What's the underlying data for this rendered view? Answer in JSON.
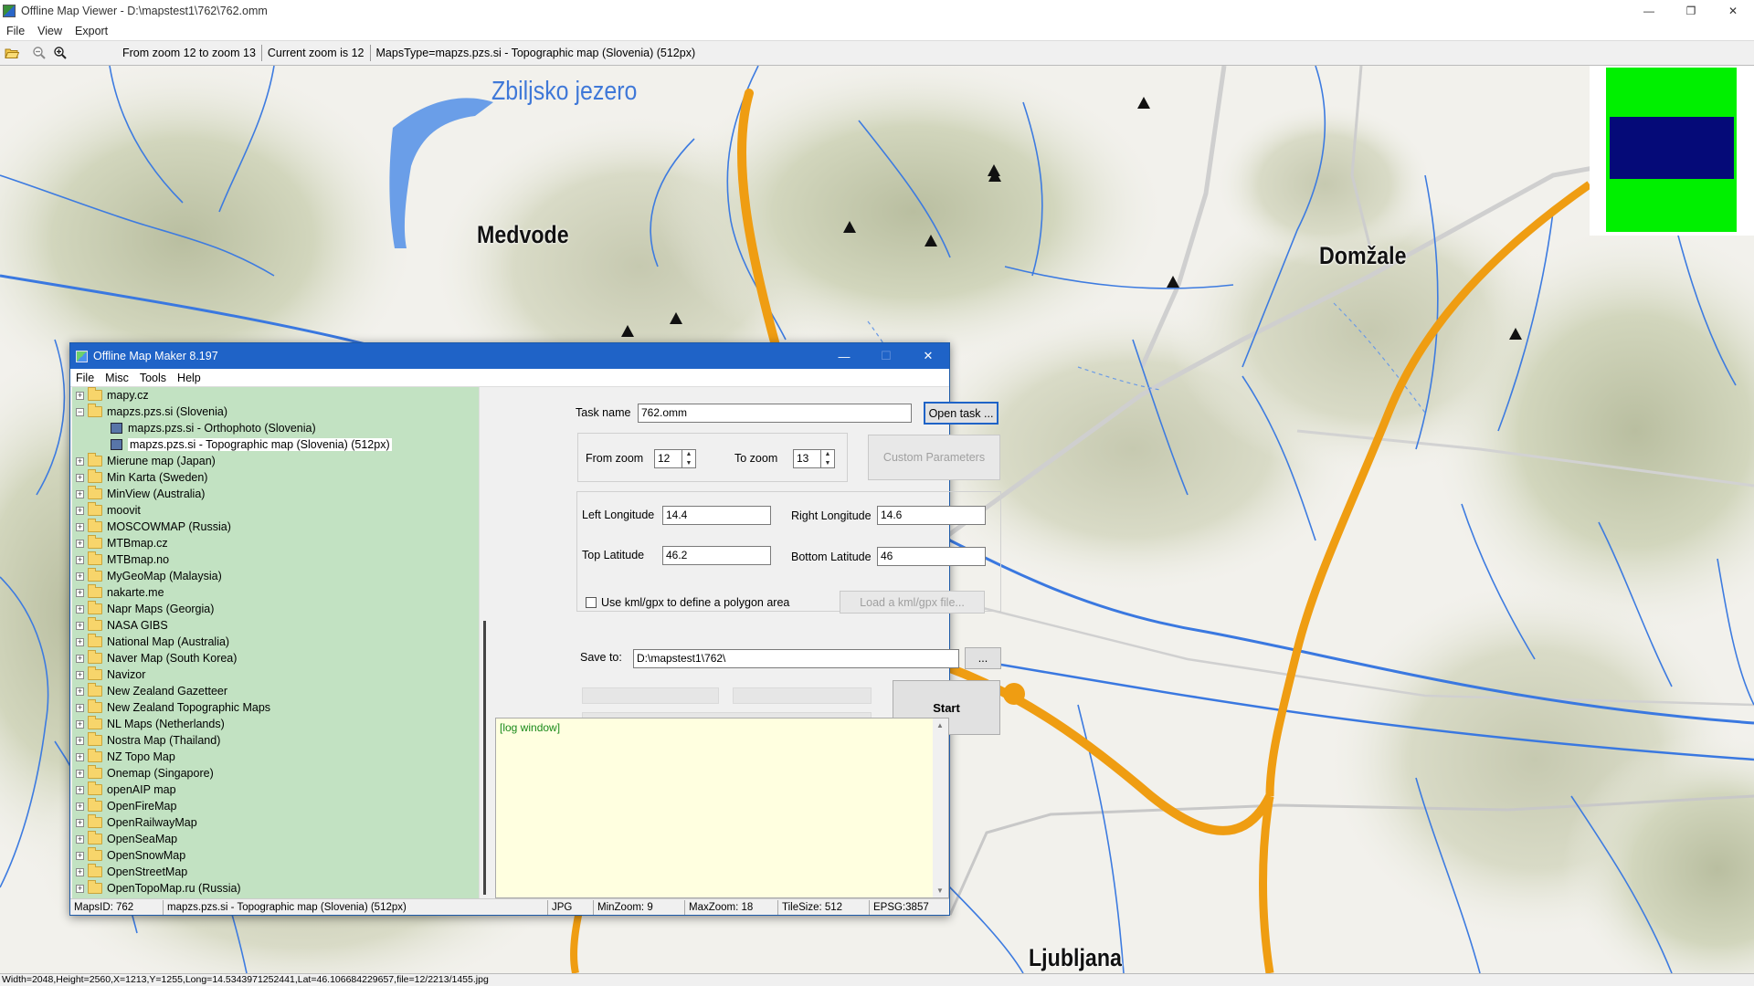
{
  "window": {
    "title": "Offline Map Viewer - D:\\mapstest1\\762\\762.omm",
    "controls": [
      "—",
      "❐",
      "✕"
    ]
  },
  "menu": [
    "File",
    "View",
    "Export"
  ],
  "toolbar": {
    "zoom_range": "From zoom 12 to zoom 13",
    "current_zoom": "Current zoom is 12",
    "maps_type": "MapsType=mapzs.pzs.si - Topographic map (Slovenia) (512px)"
  },
  "map": {
    "lake_label": "Zbiljsko jezero",
    "places": [
      "Medvode",
      "Domžale",
      "Ljubljana"
    ],
    "minimap_colors": {
      "frame": "#00f000",
      "view": "#050a78"
    }
  },
  "statusbar": "Width=2048,Height=2560,X=1213,Y=1255,Long=14.5343971252441,Lat=46.106684229657,file=12/2213/1455.jpg",
  "dialog": {
    "title": "Offline Map Maker 8.197",
    "menu": [
      "File",
      "Misc",
      "Tools",
      "Help"
    ],
    "tree": [
      {
        "label": "mapy.cz",
        "expanded": false
      },
      {
        "label": "mapzs.pzs.si (Slovenia)",
        "expanded": true
      },
      {
        "label": "mapzs.pzs.si - Orthophoto (Slovenia)",
        "child": true
      },
      {
        "label": "mapzs.pzs.si - Topographic map (Slovenia) (512px)",
        "child": true,
        "selected": true
      },
      {
        "label": "Mierune map (Japan)"
      },
      {
        "label": "Min Karta (Sweden)"
      },
      {
        "label": "MinView (Australia)"
      },
      {
        "label": "moovit"
      },
      {
        "label": "MOSCOWMAP (Russia)"
      },
      {
        "label": "MTBmap.cz"
      },
      {
        "label": "MTBmap.no"
      },
      {
        "label": "MyGeoMap (Malaysia)"
      },
      {
        "label": "nakarte.me"
      },
      {
        "label": "Napr Maps (Georgia)"
      },
      {
        "label": "NASA GIBS"
      },
      {
        "label": "National Map (Australia)"
      },
      {
        "label": "Naver Map (South Korea)"
      },
      {
        "label": "Navizor"
      },
      {
        "label": "New Zealand Gazetteer"
      },
      {
        "label": "New Zealand Topographic Maps"
      },
      {
        "label": "NL Maps (Netherlands)"
      },
      {
        "label": "Nostra Map (Thailand)"
      },
      {
        "label": "NZ Topo Map"
      },
      {
        "label": "Onemap (Singapore)"
      },
      {
        "label": "openAIP map"
      },
      {
        "label": "OpenFireMap"
      },
      {
        "label": "OpenRailwayMap"
      },
      {
        "label": "OpenSeaMap"
      },
      {
        "label": "OpenSnowMap"
      },
      {
        "label": "OpenStreetMap"
      },
      {
        "label": "OpenTopoMap.ru (Russia)"
      }
    ],
    "form": {
      "task_name_label": "Task name",
      "task_name_value": "762.omm",
      "open_task_button": "Open task ...",
      "from_zoom_label": "From zoom",
      "from_zoom_value": "12",
      "to_zoom_label": "To zoom",
      "to_zoom_value": "13",
      "custom_params_button": "Custom Parameters",
      "left_lon_label": "Left Longitude",
      "left_lon_value": "14.4",
      "right_lon_label": "Right Longitude",
      "right_lon_value": "14.6",
      "top_lat_label": "Top Latitude",
      "top_lat_value": "46.2",
      "bottom_lat_label": "Bottom Latitude",
      "bottom_lat_value": "46",
      "kml_checkbox_label": "Use kml/gpx to define a polygon area",
      "kml_checked": false,
      "load_kml_button": "Load a kml/gpx file...",
      "save_to_label": "Save to:",
      "save_to_value": "D:\\mapstest1\\762\\",
      "browse_button": "...",
      "start_button": "Start"
    },
    "log_text": "[log window]",
    "status": {
      "maps_id": "MapsID: 762",
      "map_name": "mapzs.pzs.si - Topographic map (Slovenia) (512px)",
      "format": "JPG",
      "min_zoom": "MinZoom: 9",
      "max_zoom": "MaxZoom: 18",
      "tile_size": "TileSize: 512",
      "epsg": "EPSG:3857"
    }
  }
}
